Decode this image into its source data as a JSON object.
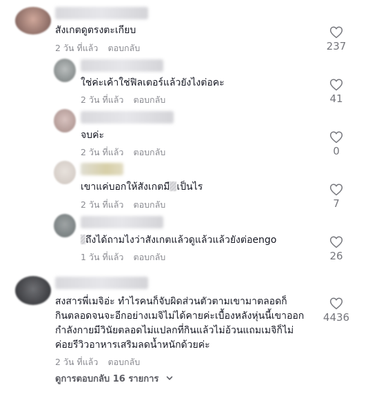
{
  "comments": [
    {
      "text": "สังเกตดูตรงตะเกียบ",
      "time": "2 วัน ที่แล้ว",
      "reply": "ตอบกลับ",
      "likes": "237"
    },
    {
      "text": "ใช่ค่ะเค้าใช่ฟิลเตอร์แล้วยังไงต่อคะ",
      "time": "2 วัน ที่แล้ว",
      "reply": "ตอบกลับ",
      "likes": "41"
    },
    {
      "text": "จบค่ะ",
      "time": "2 วัน ที่แล้ว",
      "reply": "ตอบกลับ",
      "likes": "0"
    },
    {
      "text_before": "เขาแค่บอกให้สังเกตมื",
      "text_after": "เป็นไร",
      "time": "2 วัน ที่แล้ว",
      "reply": "ตอบกลับ",
      "likes": "7"
    },
    {
      "text_after": "ถึงได้ถามไงว่าสังเกตแล้วดูแล้วแล้วยังต่อengo",
      "time": "1 วัน ที่แล้ว",
      "reply": "ตอบกลับ",
      "likes": "26"
    },
    {
      "lines": [
        "สงสารพี่เมจิอ่ะ ทำไรคนก็จับผิดส่วนตัวตามเขามาตลอดก็",
        "กินตลอดจนจะอีกอย่างเมจิไม่ได้คายค่ะเบื้องหลังหุ่นนี้เขาออก",
        "กำลังกายมีวินัยตลอดไม่แปลกที่กินแล้วไม่อ้วนแถมเมจิก็ไม่",
        "ค่อยรีวิวอาหารเสริมลดน้ำหนักด้วยค่ะ"
      ],
      "time": "2 วัน ที่แล้ว",
      "reply": "ตอบกลับ",
      "likes": "4436"
    }
  ],
  "view_replies": "ดูการตอบกลับ 16 รายการ",
  "icons": {
    "like": "heart-outline-icon",
    "expand": "chevron-down-icon"
  },
  "colors": {
    "text": "#161823",
    "meta": "#8a8b91",
    "count": "#75767c"
  }
}
